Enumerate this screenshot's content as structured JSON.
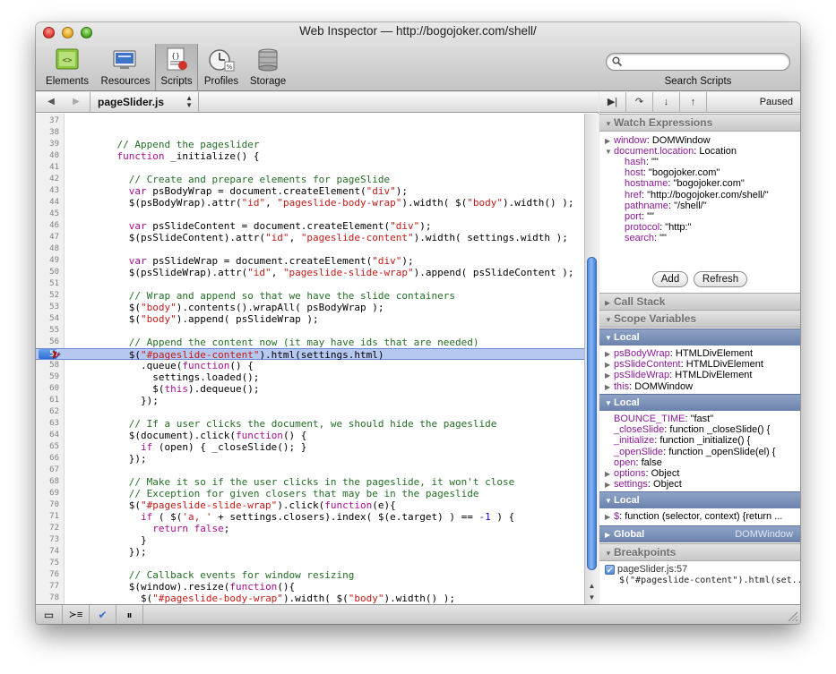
{
  "window": {
    "title": "Web Inspector — http://bogojoker.com/shell/"
  },
  "toolbar": {
    "items": [
      {
        "label": "Elements"
      },
      {
        "label": "Resources"
      },
      {
        "label": "Scripts"
      },
      {
        "label": "Profiles"
      },
      {
        "label": "Storage"
      }
    ],
    "active": "Scripts",
    "search_label": "Search Scripts",
    "search_value": ""
  },
  "script_nav": {
    "file": "pageSlider.js",
    "back_icon": "triangle-left-icon",
    "forward_icon": "triangle-right-icon"
  },
  "code": {
    "current_line": "57",
    "lines": [
      {
        "n": "37",
        "t": ""
      },
      {
        "n": "38",
        "t": ""
      },
      {
        "n": "39",
        "t": "    // Append the pageslider"
      },
      {
        "n": "40",
        "t": "    function _initialize() {"
      },
      {
        "n": "41",
        "t": ""
      },
      {
        "n": "42",
        "t": "      // Create and prepare elements for pageSlide"
      },
      {
        "n": "43",
        "t": "      var psBodyWrap = document.createElement(\"div\");"
      },
      {
        "n": "44",
        "t": "      $(psBodyWrap).attr(\"id\", \"pageslide-body-wrap\").width( $(\"body\").width() );"
      },
      {
        "n": "45",
        "t": ""
      },
      {
        "n": "46",
        "t": "      var psSlideContent = document.createElement(\"div\");"
      },
      {
        "n": "47",
        "t": "      $(psSlideContent).attr(\"id\", \"pageslide-content\").width( settings.width );"
      },
      {
        "n": "48",
        "t": ""
      },
      {
        "n": "49",
        "t": "      var psSlideWrap = document.createElement(\"div\");"
      },
      {
        "n": "50",
        "t": "      $(psSlideWrap).attr(\"id\", \"pageslide-slide-wrap\").append( psSlideContent );"
      },
      {
        "n": "51",
        "t": ""
      },
      {
        "n": "52",
        "t": "      // Wrap and append so that we have the slide containers"
      },
      {
        "n": "53",
        "t": "      $(\"body\").contents().wrapAll( psBodyWrap );"
      },
      {
        "n": "54",
        "t": "      $(\"body\").append( psSlideWrap );"
      },
      {
        "n": "55",
        "t": ""
      },
      {
        "n": "56",
        "t": "      // Append the content now (it may have ids that are needed)"
      },
      {
        "n": "57",
        "t": "      $(\"#pageslide-content\").html(settings.html)"
      },
      {
        "n": "58",
        "t": "        .queue(function() {"
      },
      {
        "n": "59",
        "t": "          settings.loaded();"
      },
      {
        "n": "60",
        "t": "          $(this).dequeue();"
      },
      {
        "n": "61",
        "t": "        });"
      },
      {
        "n": "62",
        "t": ""
      },
      {
        "n": "63",
        "t": "      // If a user clicks the document, we should hide the pageslide"
      },
      {
        "n": "64",
        "t": "      $(document).click(function() {"
      },
      {
        "n": "65",
        "t": "        if (open) { _closeSlide(); }"
      },
      {
        "n": "66",
        "t": "      });"
      },
      {
        "n": "67",
        "t": ""
      },
      {
        "n": "68",
        "t": "      // Make it so if the user clicks in the pageslide, it won't close"
      },
      {
        "n": "69",
        "t": "      // Exception for given closers that may be in the pageslide"
      },
      {
        "n": "70",
        "t": "      $(\"#pageslide-slide-wrap\").click(function(e){"
      },
      {
        "n": "71",
        "t": "        if ( $('a, ' + settings.closers).index( $(e.target) ) == -1 ) {"
      },
      {
        "n": "72",
        "t": "          return false;"
      },
      {
        "n": "73",
        "t": "        }"
      },
      {
        "n": "74",
        "t": "      });"
      },
      {
        "n": "75",
        "t": ""
      },
      {
        "n": "76",
        "t": "      // Callback events for window resizing"
      },
      {
        "n": "77",
        "t": "      $(window).resize(function(){"
      },
      {
        "n": "78",
        "t": "        $(\"#pageslide-body-wrap\").width( $(\"body\").width() );"
      }
    ]
  },
  "debugger": {
    "paused_label": "Paused",
    "controls": [
      {
        "icon": "continue-icon",
        "glyph": "▶|"
      },
      {
        "icon": "step-over-icon",
        "glyph": "↷"
      },
      {
        "icon": "step-into-icon",
        "glyph": "↓"
      },
      {
        "icon": "step-out-icon",
        "glyph": "↑"
      }
    ]
  },
  "watch": {
    "title": "Watch Expressions",
    "window": {
      "key": "window",
      "value": "DOMWindow"
    },
    "location": {
      "key": "document.location",
      "value": "Location"
    },
    "props": [
      {
        "key": "hash",
        "value": "\"\""
      },
      {
        "key": "host",
        "value": "\"bogojoker.com\""
      },
      {
        "key": "hostname",
        "value": "\"bogojoker.com\""
      },
      {
        "key": "href",
        "value": "\"http://bogojoker.com/shell/\""
      },
      {
        "key": "pathname",
        "value": "\"/shell/\""
      },
      {
        "key": "port",
        "value": "\"\""
      },
      {
        "key": "protocol",
        "value": "\"http:\""
      },
      {
        "key": "search",
        "value": "\"\""
      }
    ],
    "add_label": "Add",
    "refresh_label": "Refresh"
  },
  "call_stack": {
    "title": "Call Stack"
  },
  "scope": {
    "title": "Scope Variables",
    "local1": {
      "title": "Local",
      "props": [
        {
          "key": "psBodyWrap",
          "value": "HTMLDivElement"
        },
        {
          "key": "psSlideContent",
          "value": "HTMLDivElement"
        },
        {
          "key": "psSlideWrap",
          "value": "HTMLDivElement"
        },
        {
          "key": "this",
          "value": "DOMWindow"
        }
      ]
    },
    "local2": {
      "title": "Local",
      "props": [
        {
          "key": "BOUNCE_TIME",
          "value": "\"fast\"",
          "expandable": false
        },
        {
          "key": "_closeSlide",
          "value": "function _closeSlide() {",
          "expandable": false
        },
        {
          "key": "_initialize",
          "value": "function _initialize() {",
          "expandable": false
        },
        {
          "key": "_openSlide",
          "value": "function _openSlide(el) {",
          "expandable": false
        },
        {
          "key": "open",
          "value": "false",
          "expandable": false
        },
        {
          "key": "options",
          "value": "Object",
          "expandable": true
        },
        {
          "key": "settings",
          "value": "Object",
          "expandable": true
        }
      ]
    },
    "local3": {
      "title": "Local",
      "props": [
        {
          "key": "$",
          "value": "function (selector, context) {return ..."
        }
      ]
    },
    "global": {
      "title": "Global",
      "value": "DOMWindow"
    }
  },
  "breakpoints": {
    "title": "Breakpoints",
    "items": [
      {
        "location": "pageSlider.js:57",
        "code": "$(\"#pageslide-content\").html(set..."
      }
    ]
  },
  "statusbar": {
    "buttons": [
      {
        "icon": "dock-icon",
        "glyph": "▭"
      },
      {
        "icon": "console-icon",
        "glyph": "≻≡"
      },
      {
        "icon": "breakpoints-toggle-icon",
        "glyph": "✔"
      },
      {
        "icon": "pause-on-exceptions-icon",
        "glyph": "⏸"
      }
    ]
  }
}
